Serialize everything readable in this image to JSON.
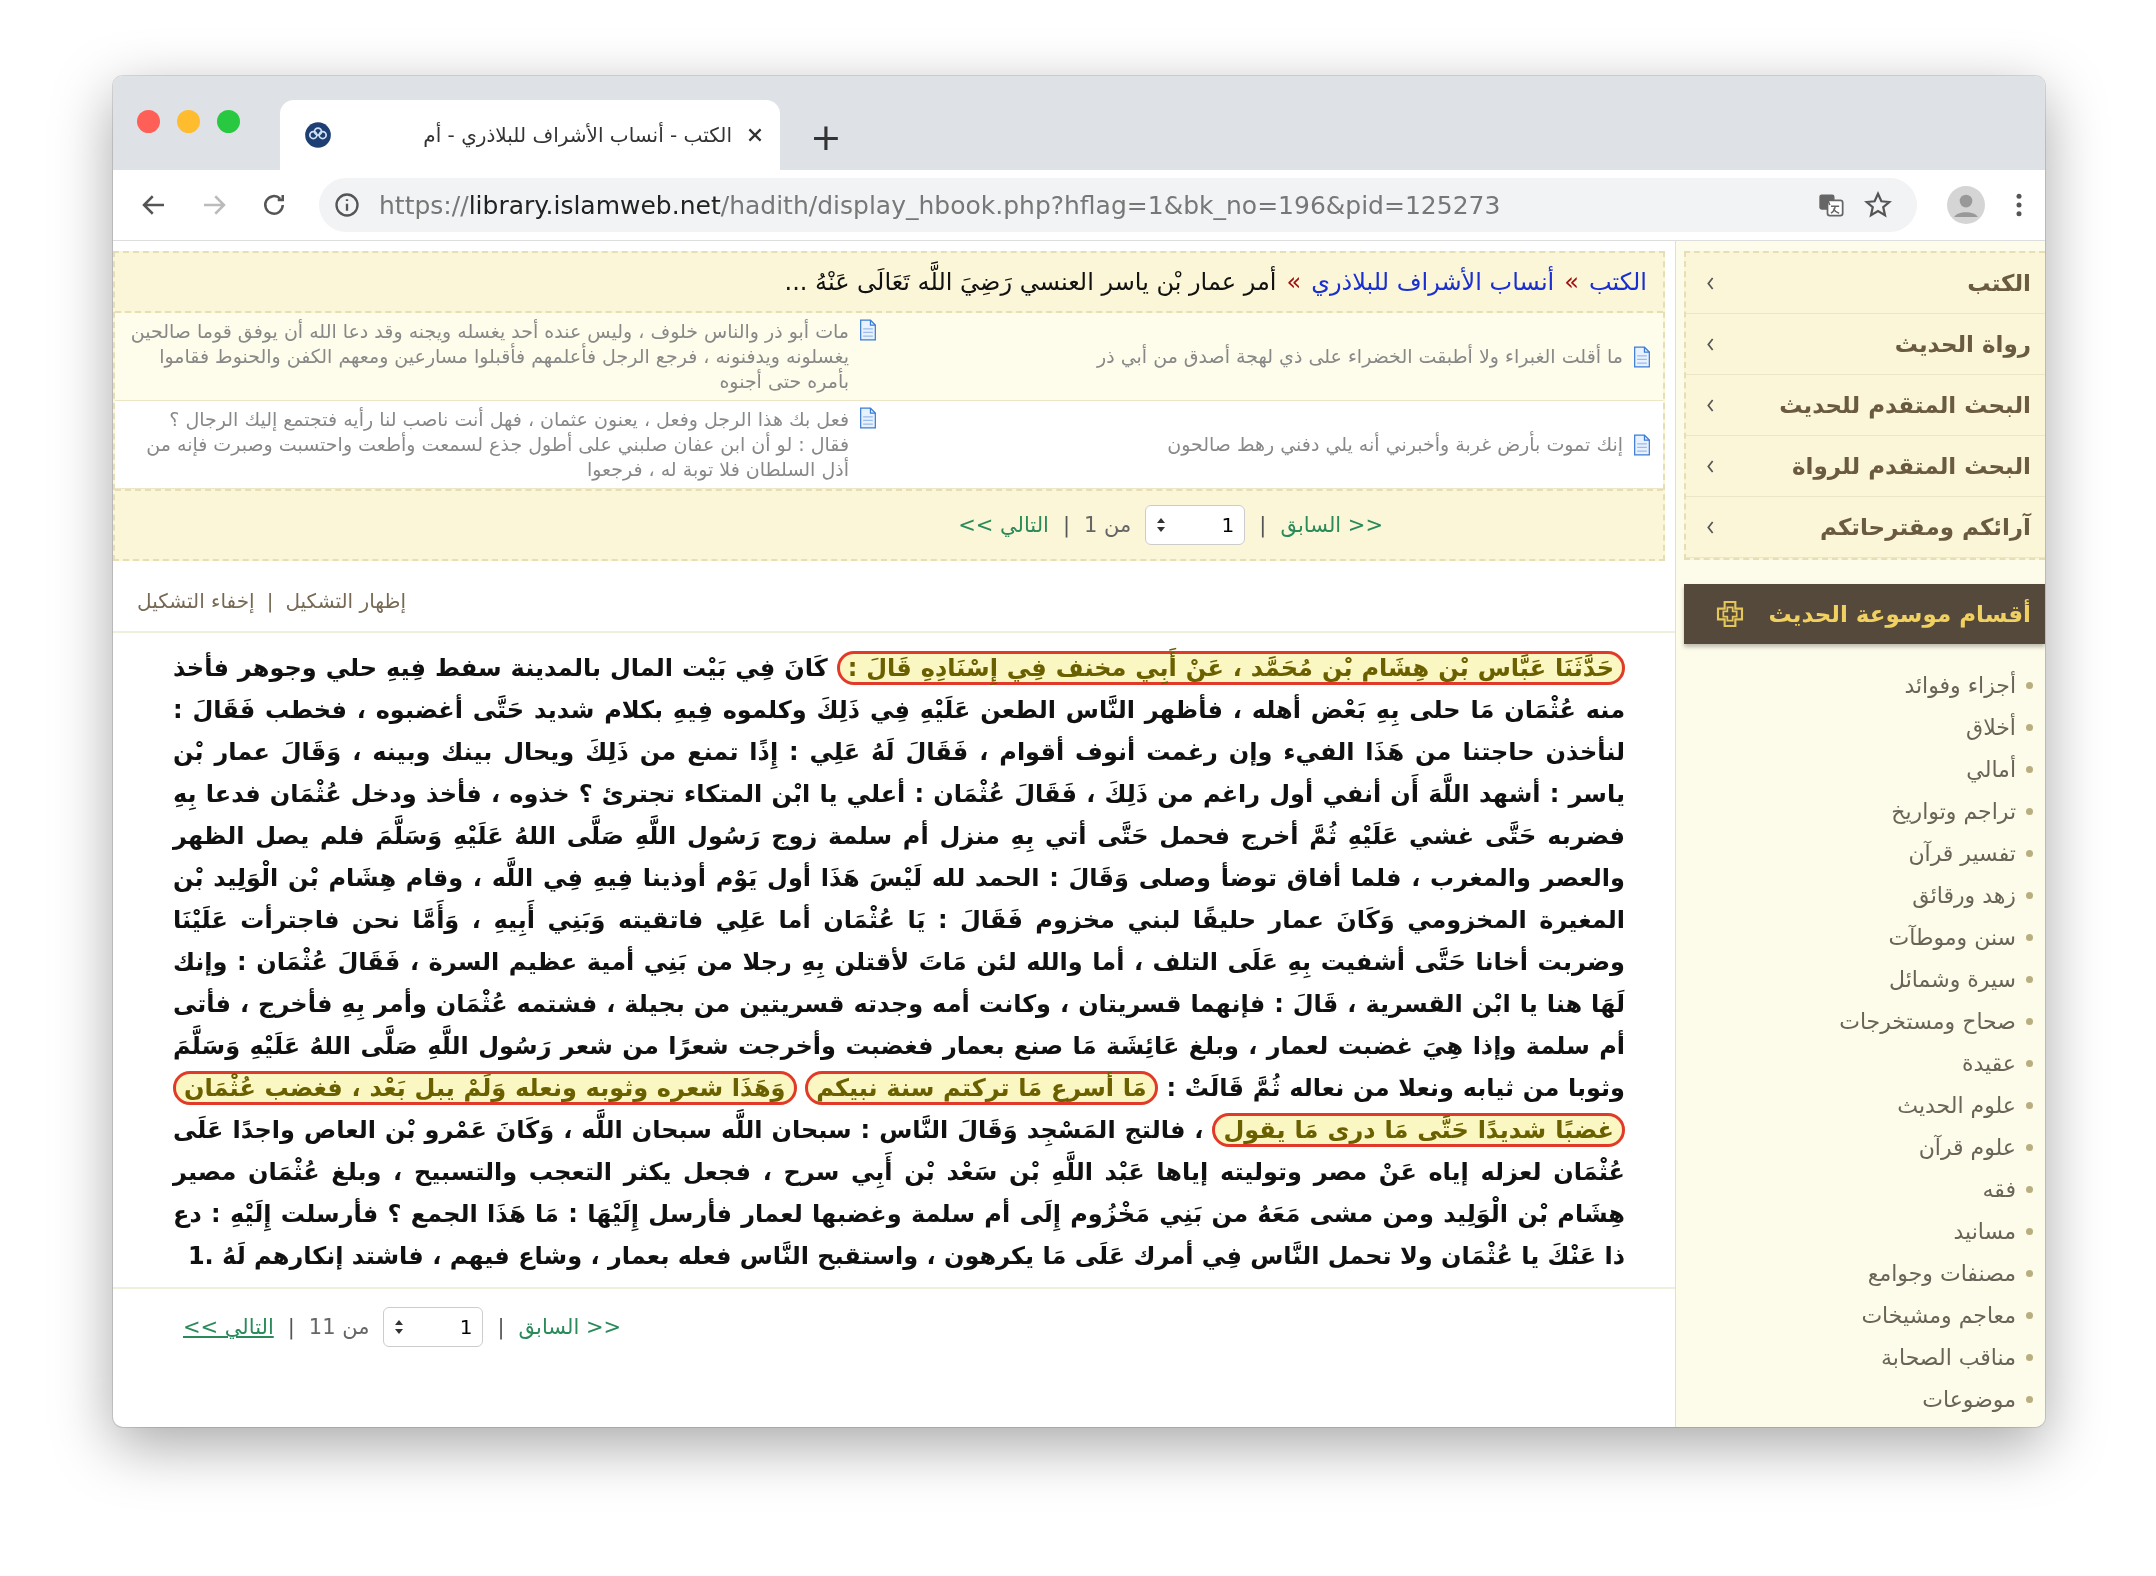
{
  "browser": {
    "tab_title": "الكتب - أنساب الأشراف للبلاذري - أم",
    "new_tab": "+",
    "url": {
      "scheme": "https://",
      "host": "library.islamweb.net",
      "path": "/hadith/display_hbook.php?hflag=1&bk_no=196&pid=125273"
    }
  },
  "breadcrumb": {
    "links": [
      "الكتب",
      "أنساب الأشراف للبلاذري"
    ],
    "separator": "»",
    "current": "أمر عمار بْن ياسر العنسي رَضِيَ اللَّه تَعَالَى عَنْهُ ..."
  },
  "related": [
    {
      "text": "ما أقلت الغبراء ولا أطبقت الخضراء على ذي لهجة أصدق من أبي ذر"
    },
    {
      "text": "مات أبو ذر والناس خلوف ، وليس عنده أحد يغسله ويجنه وقد دعا الله أن يوفق قوما صالحين يغسلونه ويدفنونه ، فرجع الرجل فأعلمهم فأقبلوا مسارعين ومعهم الكفن والحنوط فقاموا بأمره حتى أجنوه"
    },
    {
      "text": "إنك تموت بأرض غربة وأخبرني أنه يلي دفني رهط صالحون"
    },
    {
      "text": "فعل بك هذا الرجل وفعل ، يعنون عثمان ، فهل أنت ناصب لنا رأيه فتجتمع إليك الرجال ؟ فقال : لو أن ابن عفان صلبني على أطول جذع لسمعت وأطعت واحتسبت وصبرت فإنه من أذل السلطان فلا توبة له ، فرجعوا"
    }
  ],
  "top_pager": {
    "prev": "<< السابق",
    "separator": "|",
    "page": "1",
    "of": "من 1",
    "next": "التالي >>"
  },
  "diacritics": {
    "show": "إظهار التشكيل",
    "separator": "|",
    "hide": "إخفاء التشكيل"
  },
  "text_segments": [
    {
      "text": "حَدَّثَنَا عَبَّاس بْن هِشَام بْن مُحَمَّد ، عَنْ أَبِي مخنف فِي إِسْنَادِهِ قَالَ :",
      "highlighted": true
    },
    {
      "text": "كَانَ فِي بَيْت المال بالمدينة سفط فِيهِ حلي وجوهر فأخذ منه عُثْمَان مَا حلى بِهِ بَعْض أهله ، فأظهر النَّاس الطعن عَلَيْهِ فِي ذَلِكَ وكلموه فِيهِ بكلام شديد حَتَّى أغضبوه ، فخطب فَقَالَ : لنأخذن حاجتنا من هَذَا الفيء وإن رغمت أنوف أقوام ، فَقَالَ لَهُ عَلِي : إِذًا تمنع من ذَلِكَ ويحال بينك وبينه ، وَقَالَ عمار بْن ياسر : أشهد اللَّهَ أَن أنفي أول راغم من ذَلِكَ ، فَقَالَ عُثْمَان : أعلي يا ابْن المتكاء تجترئ ؟ خذوه ، فأخذ ودخل عُثْمَان فدعا بِهِ فضربه حَتَّى غشي عَلَيْهِ ثُمَّ أخرج فحمل حَتَّى أتي بِهِ منزل أم سلمة زوج رَسُول اللَّهِ صَلَّى اللهُ عَلَيْهِ وَسَلَّمَ فلم يصل الظهر والعصر والمغرب ، فلما أفاق توضأ وصلى وَقَالَ : الحمد لله لَيْسَ هَذَا أول يَوْم أوذينا فِيهِ فِي اللَّه ، وقام هِشَام بْن الْوَلِيد بْن المغيرة المخزومي وَكَانَ عمار حليفًا لبني مخزوم فَقَالَ : يَا عُثْمَان أما عَلِي فاتقيته وَبَنِي أَبِيهِ ، وَأَمَّا نحن فاجترأت عَلَيْنَا وضربت أخانا حَتَّى أشفيت بِهِ عَلَى التلف ، أما والله لئن مَاتَ لأقتلن بِهِ رجلا من بَنِي أمية عظيم السرة ، فَقَالَ عُثْمَان : وإنك لَهَا هنا يا ابْن القسرية ، قَالَ : فإنهما قسريتان ، وكانت أمه وجدته قسريتين من بجيلة ، فشتمه عُثْمَان وأمر بِهِ فأخرج ، فأتى أم سلمة وإذا هِيَ غضبت لعمار ، وبلغ عَائِشَة مَا صنع بعمار فغضبت وأخرجت شعرًا من شعر رَسُول اللَّهِ صَلَّى اللهُ عَلَيْهِ وَسَلَّمَ وثوبا من ثيابه ونعلا من نعاله ثُمَّ قَالَتْ :",
      "highlighted": false
    },
    {
      "text": "مَا أسرع مَا تركتم سنة نبيكم",
      "highlighted": true
    },
    {
      "text": "وَهَذَا شعره وثوبه ونعله وَلَمْ يبل بَعْد ، فغضب عُثْمَان غضبًا شديدًا حَتَّى مَا درى مَا يقول",
      "highlighted": true
    },
    {
      "text": "، فالتج المَسْجِد وَقَالَ النَّاس : سبحان اللَّه سبحان اللَّه ، وَكَانَ عَمْرو بْن العاص واجدًا عَلَى عُثْمَان لعزله إياه عَنْ مصر وتوليته إياها عَبْد اللَّهِ بْن سَعْد بْن أَبِي سرح ، فجعل يكثر التعجب والتسبيح ، وبلغ عُثْمَان مصير هِشَام بْن الْوَلِيد ومن مشى مَعَهُ من بَنِي مَخْزُوم إِلَى أم سلمة وغضبها لعمار فأرسل إِلَيْهَا : مَا هَذَا الجمع ؟ فأرسلت إِلَيْهِ : دع ذا عَنْكَ يا عُثْمَان ولا تحمل النَّاس فِي أمرك عَلَى مَا يكرهون ، واستقبح النَّاس فعله بعمار ، وشاع فيهم ، فاشتد إنكارهم لَهُ .1",
      "highlighted": false
    }
  ],
  "bottom_pager": {
    "prev": "<< السابق",
    "separator": "|",
    "page": "1",
    "of": "من 11",
    "next": "التالي >>"
  },
  "sidebar": {
    "nav": [
      "الكتب",
      "رواة الحديث",
      "البحث المتقدم للحديث",
      "البحث المتقدم للرواة",
      "آرائكم ومقترحاتكم"
    ],
    "section_title": "أقسام موسوعة الحديث",
    "sections": [
      "أجزاء وفوائد",
      "أخلاق",
      "أمالي",
      "تراجم وتواريخ",
      "تفسير قرآن",
      "زهد ورقائق",
      "سنن وموطآت",
      "سيرة وشمائل",
      "صحاح ومستخرجات",
      "عقيدة",
      "علوم الحديث",
      "علوم قرآن",
      "فقه",
      "مسانيد",
      "مصنفات وجوامع",
      "معاجم ومشيخات",
      "مناقب الصحابة",
      "موضوعات"
    ]
  }
}
